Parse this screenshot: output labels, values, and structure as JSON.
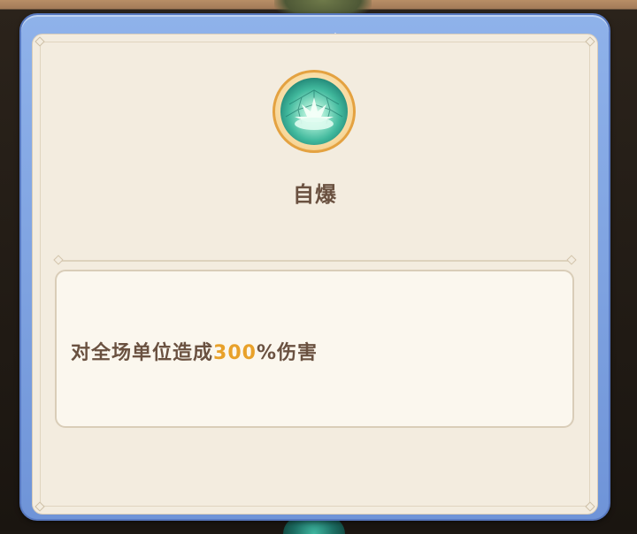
{
  "skill": {
    "name": "自爆",
    "icon": "explosion-icon",
    "description": {
      "prefix": "对全场单位造成",
      "value": "300",
      "suffix": "%伤害"
    }
  },
  "colors": {
    "frame": "#7a9de0",
    "panel": "#f3ecdf",
    "text": "#6a5140",
    "highlight": "#e8a12a",
    "icon_ring": "#e4a241",
    "icon_core": "#2f9e8a"
  }
}
